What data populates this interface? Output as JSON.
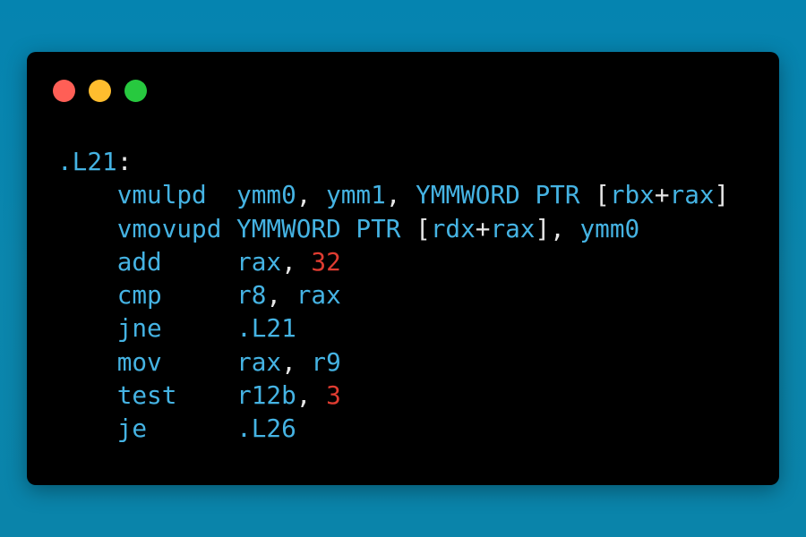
{
  "window": {
    "controls": [
      {
        "name": "close",
        "color": "#ff5f56"
      },
      {
        "name": "minimize",
        "color": "#ffbd2e"
      },
      {
        "name": "maximize",
        "color": "#27c93f"
      }
    ]
  },
  "colors": {
    "background": "#0a84aa",
    "code_background": "#000000",
    "identifier": "#45b3e3",
    "punctuation": "#e6e6e6",
    "number": "#e03c31"
  },
  "code": {
    "language": "assembly",
    "lines": [
      [
        {
          "t": ".L21",
          "k": "label"
        },
        {
          "t": ":",
          "k": "punct"
        }
      ],
      [
        {
          "t": "    ",
          "k": "ws"
        },
        {
          "t": "vmulpd",
          "k": "ins"
        },
        {
          "t": "  ",
          "k": "ws"
        },
        {
          "t": "ymm0",
          "k": "reg"
        },
        {
          "t": ", ",
          "k": "punct"
        },
        {
          "t": "ymm1",
          "k": "reg"
        },
        {
          "t": ", ",
          "k": "punct"
        },
        {
          "t": "YMMWORD PTR",
          "k": "kw"
        },
        {
          "t": " [",
          "k": "punct"
        },
        {
          "t": "rbx",
          "k": "reg"
        },
        {
          "t": "+",
          "k": "punct"
        },
        {
          "t": "rax",
          "k": "reg"
        },
        {
          "t": "]",
          "k": "punct"
        }
      ],
      [
        {
          "t": "    ",
          "k": "ws"
        },
        {
          "t": "vmovupd",
          "k": "ins"
        },
        {
          "t": " ",
          "k": "ws"
        },
        {
          "t": "YMMWORD PTR",
          "k": "kw"
        },
        {
          "t": " [",
          "k": "punct"
        },
        {
          "t": "rdx",
          "k": "reg"
        },
        {
          "t": "+",
          "k": "punct"
        },
        {
          "t": "rax",
          "k": "reg"
        },
        {
          "t": "], ",
          "k": "punct"
        },
        {
          "t": "ymm0",
          "k": "reg"
        }
      ],
      [
        {
          "t": "    ",
          "k": "ws"
        },
        {
          "t": "add",
          "k": "ins"
        },
        {
          "t": "     ",
          "k": "ws"
        },
        {
          "t": "rax",
          "k": "reg"
        },
        {
          "t": ", ",
          "k": "punct"
        },
        {
          "t": "32",
          "k": "num"
        }
      ],
      [
        {
          "t": "    ",
          "k": "ws"
        },
        {
          "t": "cmp",
          "k": "ins"
        },
        {
          "t": "     ",
          "k": "ws"
        },
        {
          "t": "r8",
          "k": "reg"
        },
        {
          "t": ", ",
          "k": "punct"
        },
        {
          "t": "rax",
          "k": "reg"
        }
      ],
      [
        {
          "t": "    ",
          "k": "ws"
        },
        {
          "t": "jne",
          "k": "ins"
        },
        {
          "t": "     ",
          "k": "ws"
        },
        {
          "t": ".L21",
          "k": "label"
        }
      ],
      [
        {
          "t": "    ",
          "k": "ws"
        },
        {
          "t": "mov",
          "k": "ins"
        },
        {
          "t": "     ",
          "k": "ws"
        },
        {
          "t": "rax",
          "k": "reg"
        },
        {
          "t": ", ",
          "k": "punct"
        },
        {
          "t": "r9",
          "k": "reg"
        }
      ],
      [
        {
          "t": "    ",
          "k": "ws"
        },
        {
          "t": "test",
          "k": "ins"
        },
        {
          "t": "    ",
          "k": "ws"
        },
        {
          "t": "r12b",
          "k": "reg"
        },
        {
          "t": ", ",
          "k": "punct"
        },
        {
          "t": "3",
          "k": "num"
        }
      ],
      [
        {
          "t": "    ",
          "k": "ws"
        },
        {
          "t": "je",
          "k": "ins"
        },
        {
          "t": "      ",
          "k": "ws"
        },
        {
          "t": ".L26",
          "k": "label"
        }
      ]
    ]
  }
}
